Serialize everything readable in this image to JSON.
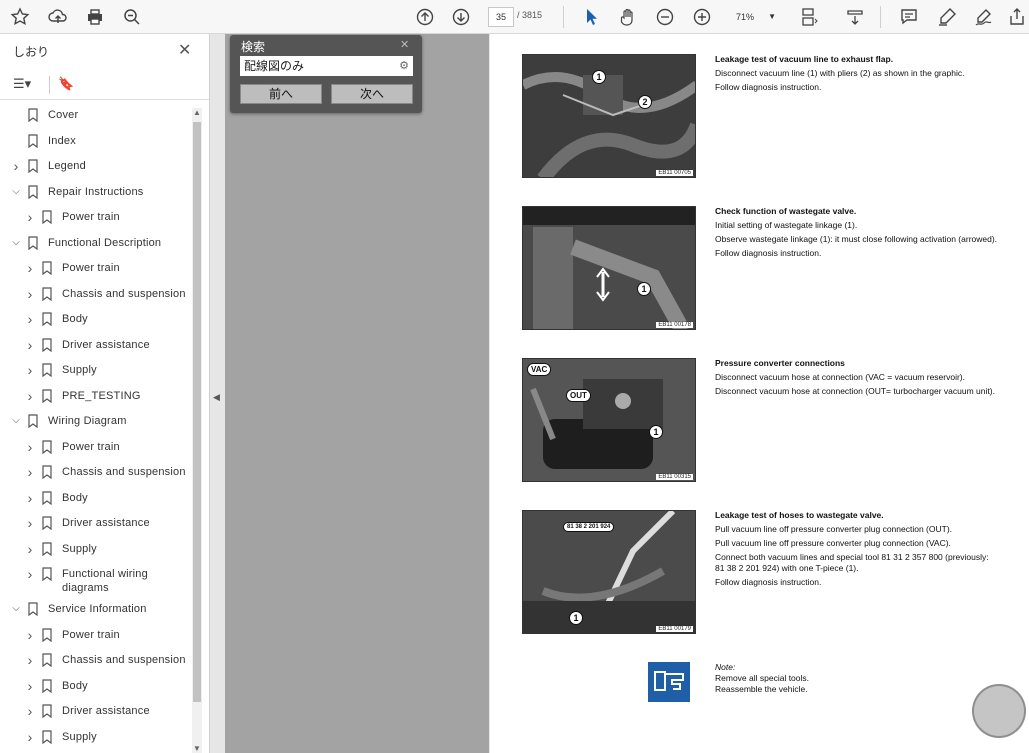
{
  "toolbar": {
    "icons_left": [
      "star-icon",
      "upload-icon",
      "print-icon",
      "zoom-search-icon"
    ],
    "page_current": "35",
    "page_total": "/ 3815",
    "zoom": "71%",
    "icons_right": [
      "comment-icon",
      "highlight-icon",
      "sign-icon",
      "share-icon"
    ]
  },
  "sidebar": {
    "title": "しおり",
    "items": [
      {
        "label": "Cover",
        "level": 0,
        "expand": "none"
      },
      {
        "label": "Index",
        "level": 0,
        "expand": "none"
      },
      {
        "label": "Legend",
        "level": 0,
        "expand": "collapsed"
      },
      {
        "label": "Repair Instructions",
        "level": 0,
        "expand": "expanded"
      },
      {
        "label": "Power train",
        "level": 1,
        "expand": "collapsed"
      },
      {
        "label": "Functional Description",
        "level": 0,
        "expand": "expanded"
      },
      {
        "label": "Power train",
        "level": 1,
        "expand": "collapsed"
      },
      {
        "label": "Chassis and suspension",
        "level": 1,
        "expand": "collapsed"
      },
      {
        "label": "Body",
        "level": 1,
        "expand": "collapsed"
      },
      {
        "label": "Driver assistance",
        "level": 1,
        "expand": "collapsed"
      },
      {
        "label": "Supply",
        "level": 1,
        "expand": "collapsed"
      },
      {
        "label": "PRE_TESTING",
        "level": 1,
        "expand": "collapsed"
      },
      {
        "label": "Wiring Diagram",
        "level": 0,
        "expand": "expanded"
      },
      {
        "label": "Power train",
        "level": 1,
        "expand": "collapsed"
      },
      {
        "label": "Chassis and suspension",
        "level": 1,
        "expand": "collapsed"
      },
      {
        "label": "Body",
        "level": 1,
        "expand": "collapsed"
      },
      {
        "label": "Driver assistance",
        "level": 1,
        "expand": "collapsed"
      },
      {
        "label": "Supply",
        "level": 1,
        "expand": "collapsed"
      },
      {
        "label": "Functional wiring diagrams",
        "level": 1,
        "expand": "collapsed"
      },
      {
        "label": "Service Information",
        "level": 0,
        "expand": "expanded"
      },
      {
        "label": "Power train",
        "level": 1,
        "expand": "collapsed"
      },
      {
        "label": "Chassis and suspension",
        "level": 1,
        "expand": "collapsed"
      },
      {
        "label": "Body",
        "level": 1,
        "expand": "collapsed"
      },
      {
        "label": "Driver assistance",
        "level": 1,
        "expand": "collapsed"
      },
      {
        "label": "Supply",
        "level": 1,
        "expand": "collapsed"
      }
    ]
  },
  "search": {
    "title": "検索",
    "value": "配線図のみ",
    "prev_label": "前へ",
    "next_label": "次へ"
  },
  "document": {
    "sections": [
      {
        "heading": "Leakage test of vacuum line to exhaust flap.",
        "lines": [
          "Disconnect vacuum line (1) with pliers (2) as shown in the graphic.",
          "Follow diagnosis instruction."
        ],
        "figure_code": "EB11 00705",
        "callouts": [
          "1",
          "2"
        ]
      },
      {
        "heading": "Check function of wastegate valve.",
        "lines": [
          "Initial setting of wastegate linkage (1).",
          "Observe wastegate linkage (1): it must close following activation (arrowed).",
          "Follow diagnosis instruction."
        ],
        "figure_code": "EB11 00178",
        "callouts": [
          "1"
        ]
      },
      {
        "heading": "Pressure converter connections",
        "lines": [
          "Disconnect vacuum hose at connection (VAC = vacuum reservoir).",
          "Disconnect vacuum hose at connection (OUT= turbocharger vacuum unit)."
        ],
        "figure_code": "EB11 00315",
        "callouts": [
          "1"
        ],
        "tags": [
          "VAC",
          "OUT"
        ]
      },
      {
        "heading": "Leakage test of hoses to wastegate valve.",
        "lines": [
          "Pull vacuum line off pressure converter plug connection (OUT).",
          "Pull vacuum line off pressure converter plug connection (VAC).",
          "Connect both vacuum lines and special tool 81 31 2 357 800 (previously: 81 38 2 201 924) with one T-piece (1).",
          "Follow diagnosis instruction."
        ],
        "figure_code": "EB11 00179",
        "callouts": [
          "1"
        ],
        "tags": [
          "81 38 2 201 924"
        ]
      }
    ],
    "note": {
      "title": "Note:",
      "lines": [
        "Remove all special tools.",
        "Reassemble the vehicle."
      ]
    }
  }
}
